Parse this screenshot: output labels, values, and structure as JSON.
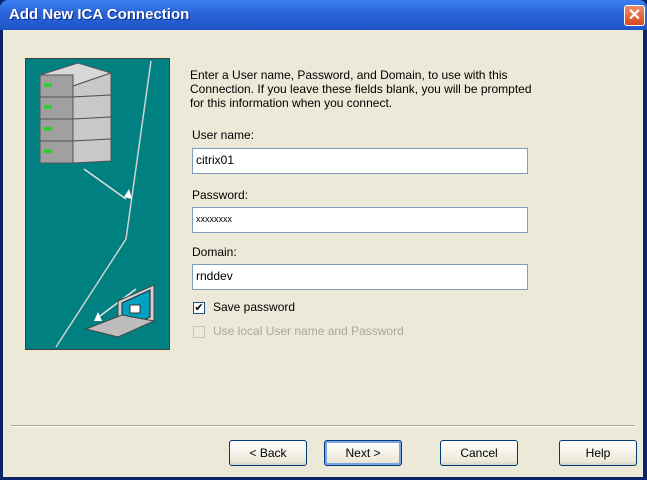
{
  "window": {
    "title": "Add New ICA Connection",
    "close_symbol": "✕"
  },
  "instructions": "Enter a User name, Password, and Domain, to use with this Connection.  If you leave these fields blank, you will be prompted for this information when you connect.",
  "fields": {
    "username": {
      "label": "User name:",
      "value": "citrix01"
    },
    "password": {
      "label": "Password:",
      "value": "xxxxxxxx"
    },
    "domain": {
      "label": "Domain:",
      "value": "rnddev"
    }
  },
  "checkboxes": {
    "save_password": {
      "label": "Save password",
      "checked": true
    },
    "use_local": {
      "label": "Use local User name and Password",
      "checked": false,
      "enabled": false
    }
  },
  "buttons": {
    "back": "< Back",
    "next": "Next >",
    "cancel": "Cancel",
    "help": "Help"
  },
  "colors": {
    "panel_teal": "#008080",
    "title_blue": "#2a63d8",
    "dialog_bg": "#ece9d8"
  }
}
